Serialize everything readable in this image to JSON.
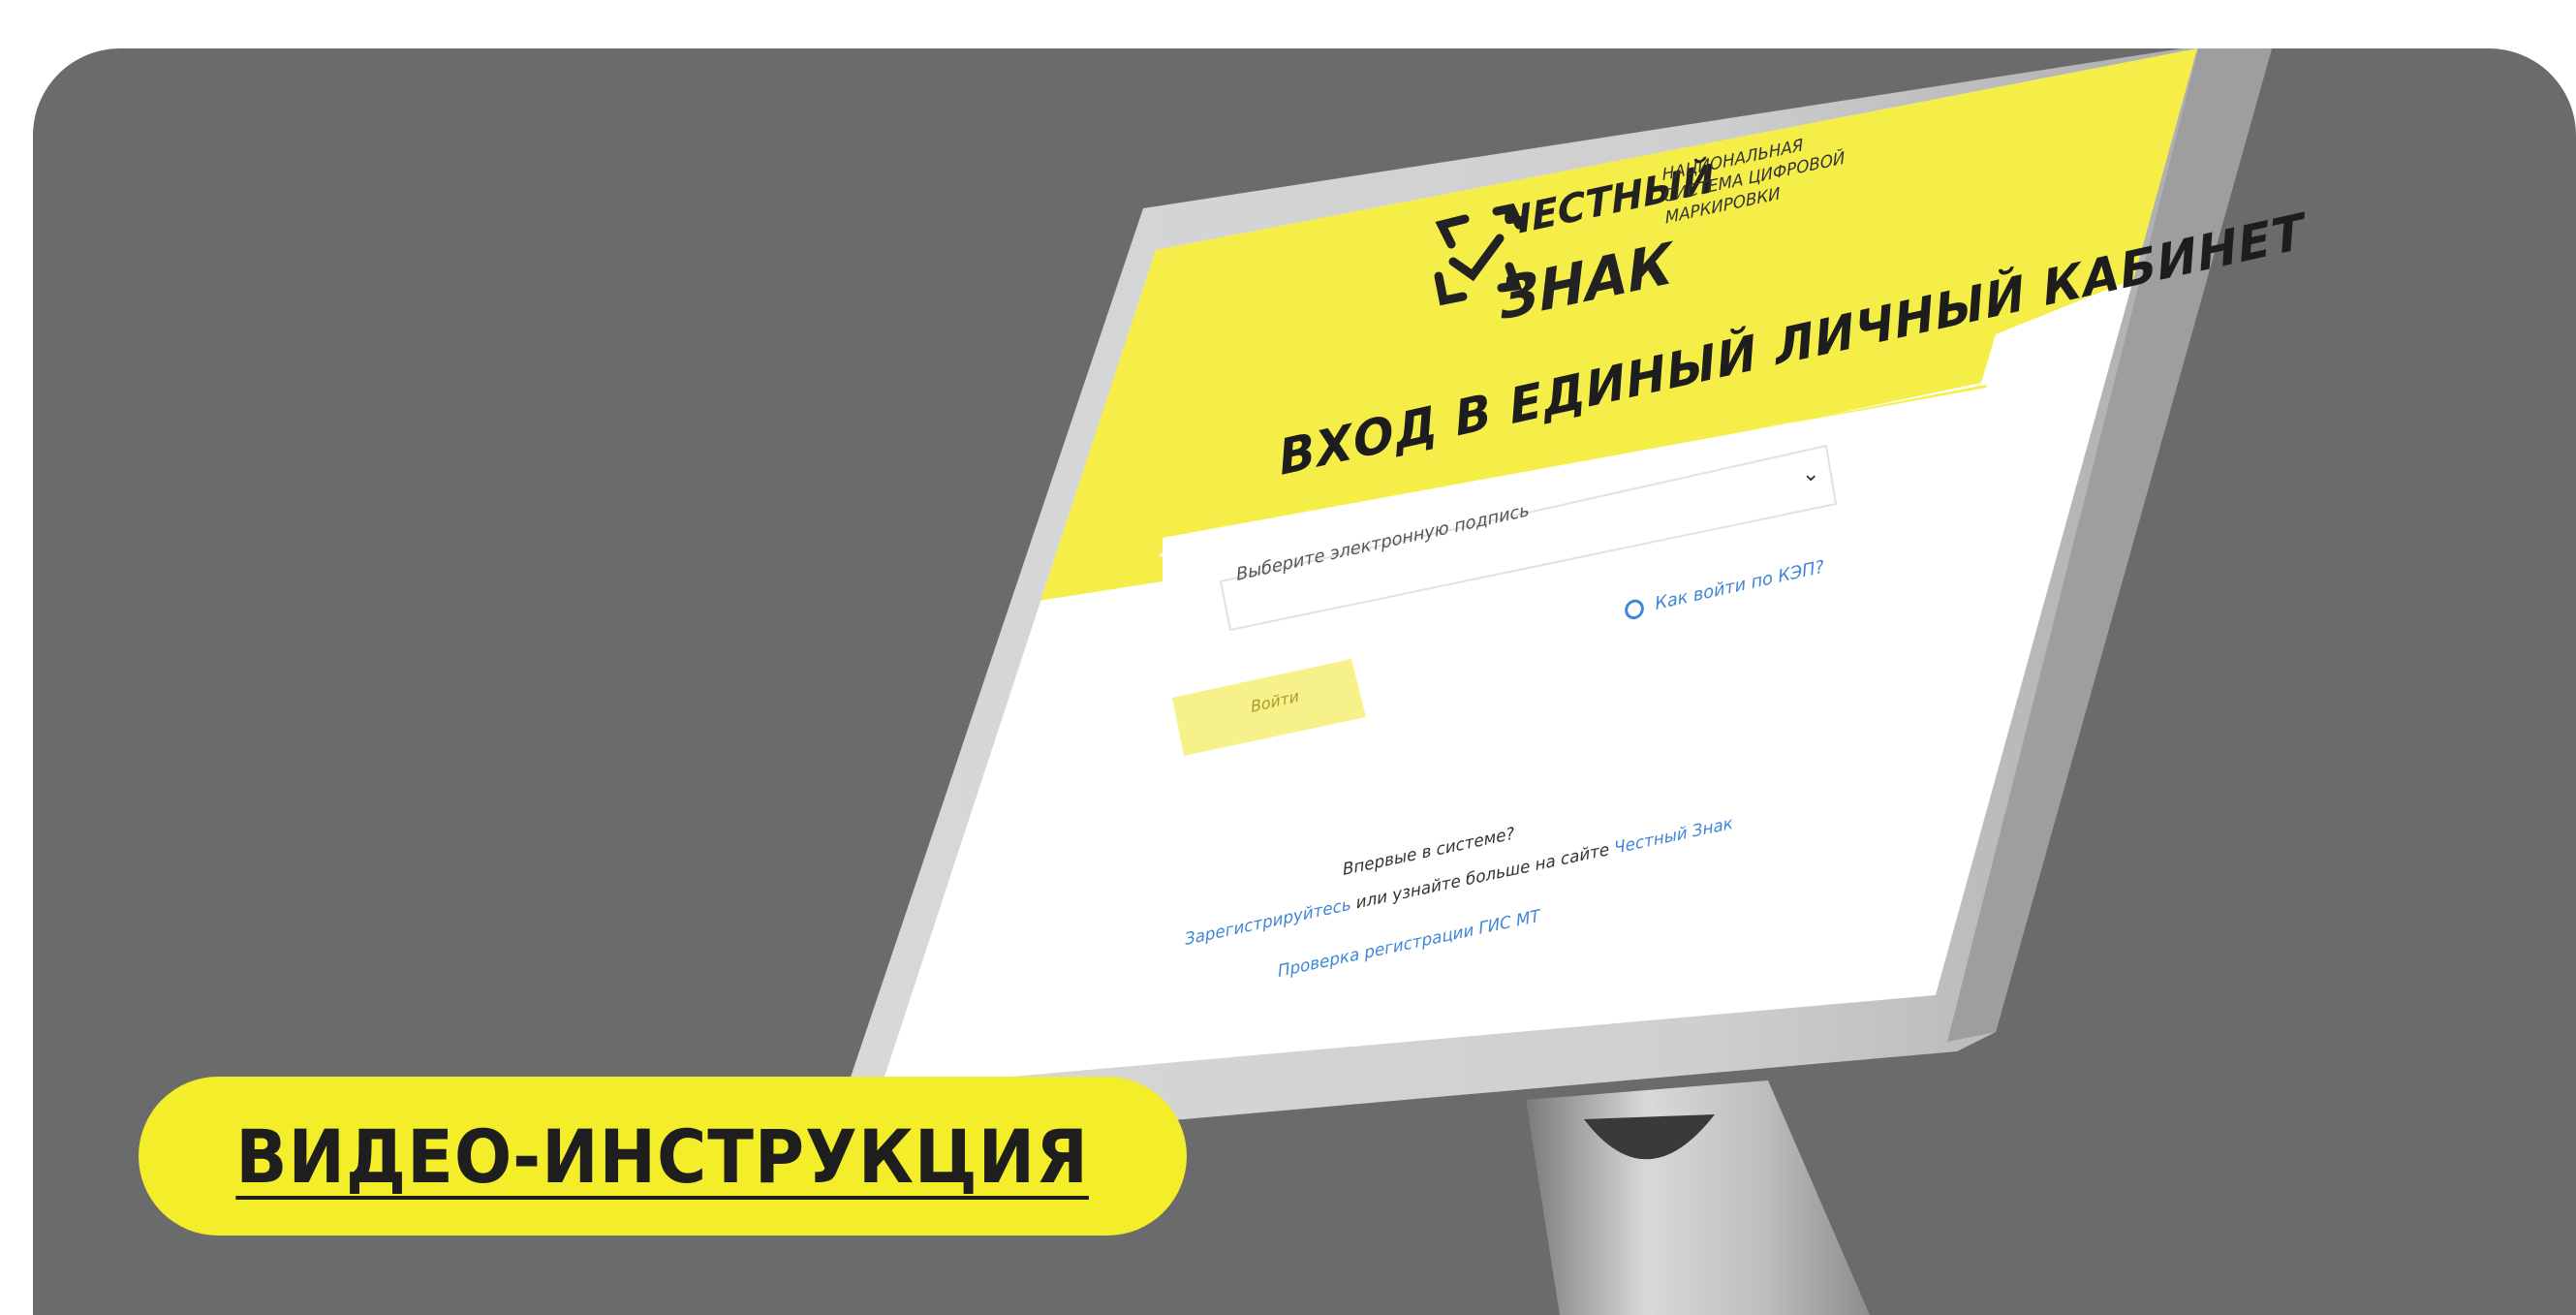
{
  "background_color": "#6b6b6b",
  "accent_color": "#f4ed2a",
  "link_color": "#3f86d8",
  "brand": {
    "top": "ЧЕСТНЫЙ",
    "bottom": "ЗНАК",
    "tagline": [
      "НАЦИОНАЛЬНАЯ",
      "СИСТЕМА ЦИФРОВОЙ",
      "МАРКИРОВКИ"
    ],
    "logo_icon": "checkmark-in-bracket-frame-icon"
  },
  "login": {
    "title": "ВХОД В ЕДИНЫЙ ЛИЧНЫЙ КАБИНЕТ",
    "signature_placeholder": "Выберите электронную подпись",
    "dropdown_icon": "chevron-down-icon",
    "help_link": "Как войти по КЭП?",
    "help_icon": "question-circle-icon",
    "login_button": "Войти"
  },
  "footer": {
    "question": "Впервые в системе?",
    "register_link": "Зарегистрируйтесь",
    "middle_text": " или узнайте больше на сайте ",
    "site_link": "Честный Знак",
    "check_link": "Проверка регистрации ГИС МТ"
  },
  "cta": {
    "label": "ВИДЕО-ИНСТРУКЦИЯ"
  }
}
